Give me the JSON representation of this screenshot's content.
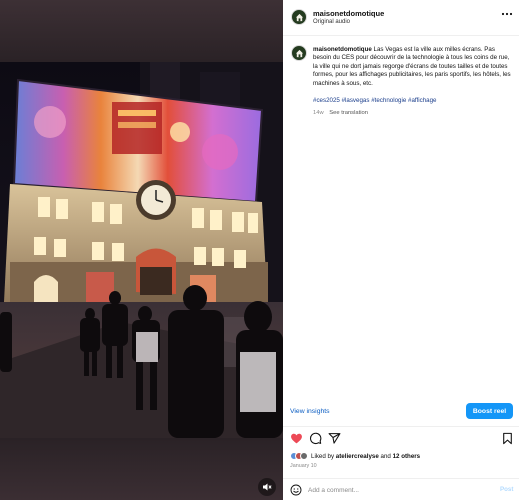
{
  "header": {
    "username": "maisonetdomotique",
    "subtitle": "Original audio",
    "more_icon": "more-horizontal-icon"
  },
  "caption": {
    "username": "maisonetdomotique",
    "text": "Las Vegas est la ville aux milles écrans. Pas besoin du CES pour découvrir de la technologie à tous les coins de rue, la ville qui ne dort jamais regorge d'écrans de toutes tailles et de toutes formes, pour les affichages publicitaires, les paris sportifs, les hôtels, les machines à sous, etc.",
    "hashtags": [
      "#ces2025",
      "#lasvegas",
      "#technologie",
      "#affichage"
    ],
    "age": "14w",
    "see_translation": "See translation"
  },
  "insights": {
    "view_insights_label": "View insights",
    "boost_label": "Boost reel"
  },
  "actions": {
    "icons": [
      "heart-icon",
      "comment-icon",
      "share-icon",
      "bookmark-icon"
    ]
  },
  "likes": {
    "liked_by_prefix": "Liked by",
    "liked_by_user": "ateliercrealyse",
    "and_text": "and",
    "others_text": "12 others"
  },
  "post": {
    "date": "January 10"
  },
  "comment": {
    "placeholder": "Add a comment...",
    "post_label": "Post"
  },
  "colors": {
    "liked_heart": "#ed4956",
    "boost_button": "#1496f7",
    "link_blue": "#1c3f8c"
  }
}
